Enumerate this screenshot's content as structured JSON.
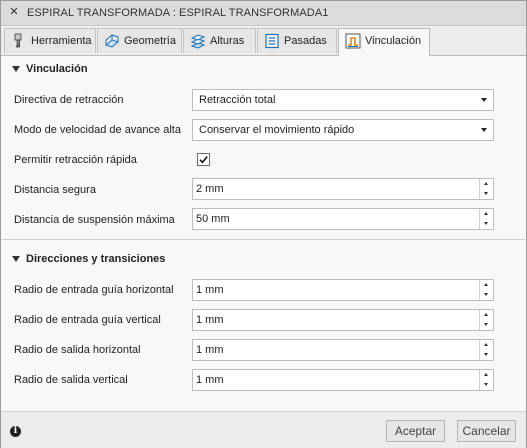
{
  "window": {
    "title": "ESPIRAL TRANSFORMADA : ESPIRAL TRANSFORMADA1",
    "close_glyph": "×"
  },
  "tabs": [
    {
      "label": "Herramienta",
      "icon": "tool-icon",
      "active": false
    },
    {
      "label": "Geometría",
      "icon": "geometry-icon",
      "active": false
    },
    {
      "label": "Alturas",
      "icon": "heights-icon",
      "active": false
    },
    {
      "label": "Pasadas",
      "icon": "passes-icon",
      "active": false
    },
    {
      "label": "Vinculación",
      "icon": "linking-icon",
      "active": true
    }
  ],
  "section_linking": {
    "title": "Vinculación",
    "retract_policy": {
      "label": "Directiva de retracción",
      "value": "Retracción total"
    },
    "high_feed_mode": {
      "label": "Modo de velocidad de avance alta",
      "value": "Conservar el movimiento rápido"
    },
    "allow_rapid_retract": {
      "label": "Permitir retracción rápida",
      "checked": true,
      "check_glyph": "✓"
    },
    "safe_distance": {
      "label": "Distancia segura",
      "value": "2 mm"
    },
    "max_stay_down": {
      "label": "Distancia de suspensión máxima",
      "value": "50 mm"
    }
  },
  "section_transitions": {
    "title": "Direcciones y transiciones",
    "horizontal_lead_in_radius": {
      "label": "Radio de entrada guía horizontal",
      "value": "1 mm"
    },
    "vertical_lead_in_radius": {
      "label": "Radio de entrada guía vertical",
      "value": "1 mm"
    },
    "horizontal_lead_out_radius": {
      "label": "Radio de salida horizontal",
      "value": "1 mm"
    },
    "vertical_lead_out_radius": {
      "label": "Radio de salida vertical",
      "value": "1 mm"
    }
  },
  "footer": {
    "info_glyph": "i",
    "ok_label": "Aceptar",
    "cancel_label": "Cancelar"
  }
}
